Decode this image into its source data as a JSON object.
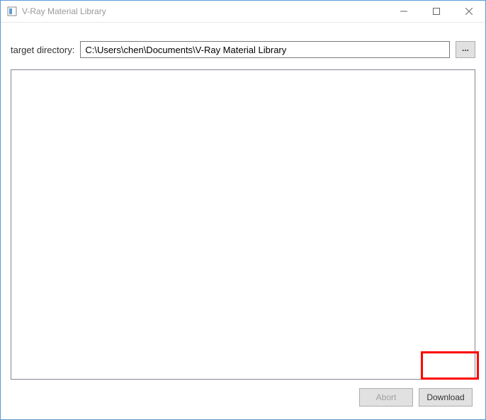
{
  "window": {
    "title": "V-Ray Material Library"
  },
  "target": {
    "label": "target directory:",
    "value": "C:\\Users\\chen\\Documents\\V-Ray Material Library",
    "browse_label": "..."
  },
  "buttons": {
    "abort": "Abort",
    "download": "Download"
  }
}
